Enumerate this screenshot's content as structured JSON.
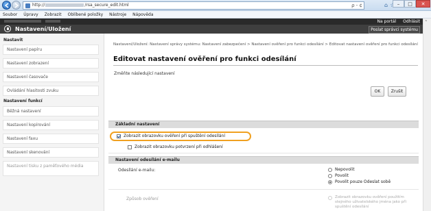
{
  "browser": {
    "address_prefix": "http://",
    "address_suffix": "/rsa_secure_edit.html",
    "address_tools": "ρ - ¢",
    "menu": [
      "Soubor",
      "Úpravy",
      "Zobrazit",
      "Oblíbené položky",
      "Nástroje",
      "Nápověda"
    ]
  },
  "header": {
    "title": "Nastavení/Uložení",
    "portal_link": "Na portál",
    "logout_link": "Odhlásit",
    "home_button": "Poslat správci systému"
  },
  "sidebar": {
    "section1": "Nastavit",
    "items1": [
      "Nastavení papíru",
      "Nastavení zobrazení",
      "Nastavení časovače",
      "Ovládání hlasitosti zvuku"
    ],
    "section2": "Nastavení funkcí",
    "items2": [
      "Běžná nastavení",
      "Nastavení kopírování",
      "Nastavení faxu",
      "Nastavení skenování",
      "Nastavení tisku z paměťového média"
    ]
  },
  "main": {
    "breadcrumb": "Nastavení/Uložení: Nastavení správy systému: Nastavení zabezpečení > Nastavení ověření pro funkci odesílání > Editovat nastavení ověření pro funkci odesílání",
    "title": "Editovat nastavení ověření pro funkci odesílání",
    "instruction": "Změňte následující nastavení",
    "ok_label": "OK",
    "cancel_label": "Zrušit",
    "basic_section": "Základní nastavení",
    "show_auth_screen": "Zobrazit obrazovku ověření při spuštění odesílání",
    "show_confirm_screen": "Zobrazit obrazovku potvrzení při odhlášení",
    "email_section": "Nastavení odesílání e-mailu",
    "email_label": "Odesílání e-mailu:",
    "email_options": [
      "Nepovolit",
      "Povolit",
      "Povolit pouze Odeslat sobě"
    ],
    "auth_method_label": "Způsob ověření",
    "auth_method_option": "Zobrazit obrazovku ověření použitím stejného uživatelského jména jako při spuštění odesílání"
  },
  "colors": {
    "highlight": "#f0a020",
    "header_bg": "#3f3f3f"
  }
}
